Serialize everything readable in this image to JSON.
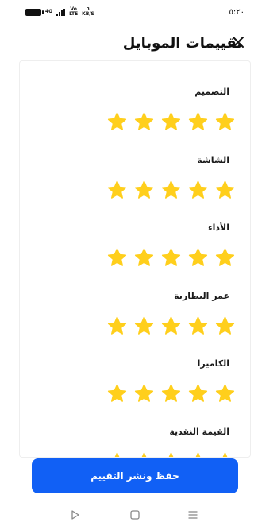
{
  "status_bar": {
    "time": "٥:٢٠",
    "network": "4G",
    "volte_top": "Vo",
    "volte_bottom": "LTE",
    "speed_value": "٦",
    "speed_unit": "KB/S"
  },
  "header": {
    "title": "تقييمات الموبايل"
  },
  "ratings": [
    {
      "label": "التصميم",
      "stars": 5
    },
    {
      "label": "الشاشة",
      "stars": 5
    },
    {
      "label": "الأداء",
      "stars": 5
    },
    {
      "label": "عمر البطارية",
      "stars": 5
    },
    {
      "label": "الكاميرا",
      "stars": 5
    },
    {
      "label": "القيمة النقدية",
      "stars": 5
    }
  ],
  "max_stars": 5,
  "submit_button": {
    "label": "حفظ ونشر التقييم"
  },
  "colors": {
    "accent": "#1160f5",
    "star": "#ffcf1c"
  },
  "icons": {
    "close": "close-icon",
    "star": "star-icon",
    "nav_back": "triangle-back-icon",
    "nav_home": "square-home-icon",
    "nav_menu": "menu-lines-icon"
  }
}
